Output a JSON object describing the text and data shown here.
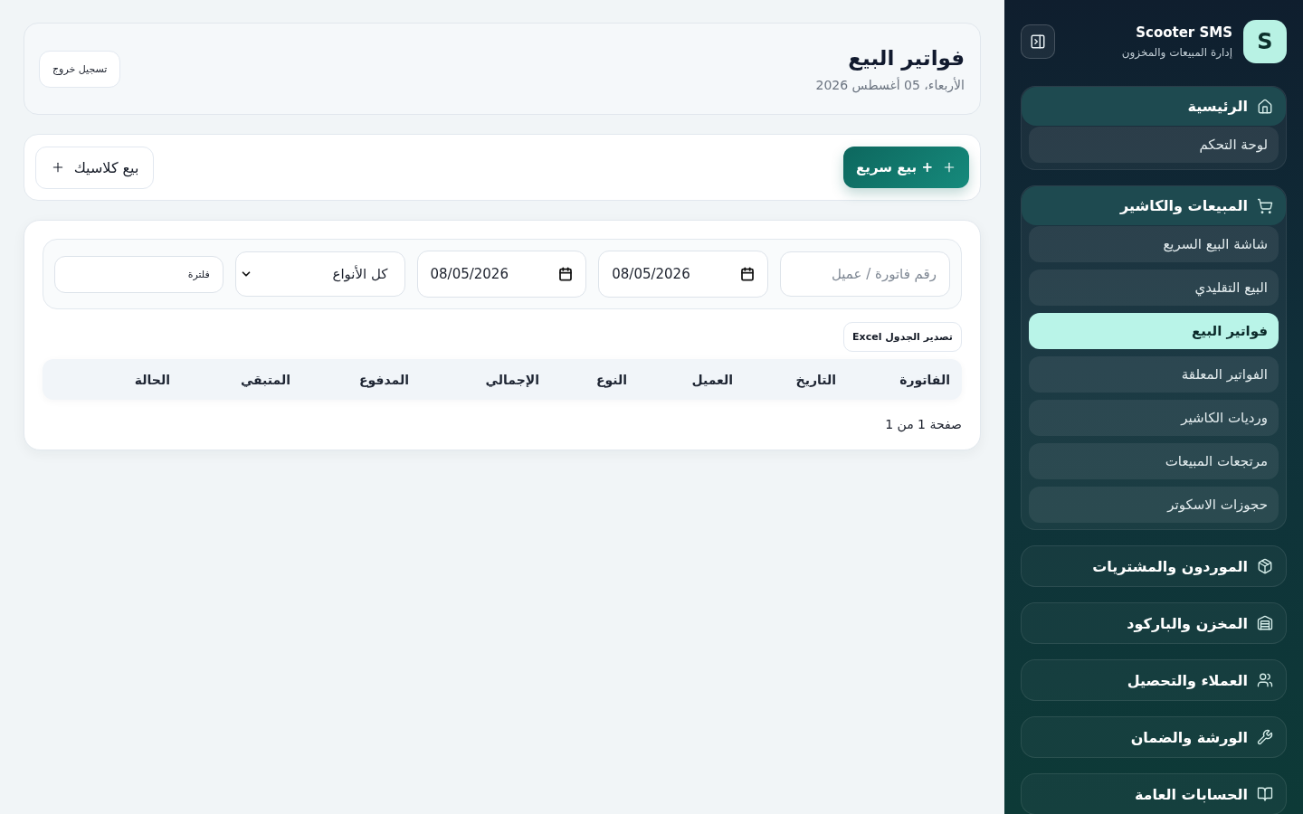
{
  "sidebar": {
    "logo": "S",
    "title": "Scooter SMS",
    "subtitle": "إدارة المبيعات والمخزون",
    "groups": [
      {
        "label": "الرئيسية",
        "expanded": true,
        "items": [
          {
            "label": "لوحة التحكم",
            "selected": false
          }
        ]
      },
      {
        "label": "المبيعات والكاشير",
        "expanded": true,
        "items": [
          {
            "label": "شاشة البيع السريع",
            "selected": false
          },
          {
            "label": "البيع التقليدي",
            "selected": false
          },
          {
            "label": "فواتير البيع",
            "selected": true
          },
          {
            "label": "الفواتير المعلقة",
            "selected": false
          },
          {
            "label": "ورديات الكاشير",
            "selected": false
          },
          {
            "label": "مرتجعات المبيعات",
            "selected": false
          },
          {
            "label": "حجوزات الاسكوتر",
            "selected": false
          }
        ]
      },
      {
        "label": "الموردون والمشتريات",
        "expanded": false
      },
      {
        "label": "المخزن والباركود",
        "expanded": false
      },
      {
        "label": "العملاء والتحصيل",
        "expanded": false
      },
      {
        "label": "الورشة والضمان",
        "expanded": false
      },
      {
        "label": "الحسابات العامة",
        "expanded": false
      }
    ]
  },
  "header": {
    "title": "فواتير البيع",
    "date": "الأربعاء، 05 أغسطس 2026",
    "logout_button": "تسجيل خروج"
  },
  "actions": {
    "quick_sale_button": "+ بيع سريع",
    "classic_sale_button": "بيع كلاسيك"
  },
  "filters": {
    "search": {
      "placeholder": "رقم فاتورة / عميل"
    },
    "date_from": {
      "value": "08/05/2026"
    },
    "date_to": {
      "value": "08/05/2026"
    },
    "type": {
      "value": "كل الأنواع"
    },
    "filter_button": "فلترة"
  },
  "export_button": "تصدير الجدول Excel",
  "table": {
    "columns": [
      "الفاتورة",
      "التاريخ",
      "العميل",
      "النوع",
      "الإجمالي",
      "المدفوع",
      "المتبقي",
      "الحالة"
    ]
  },
  "pagination": "صفحة 1 من 1"
}
